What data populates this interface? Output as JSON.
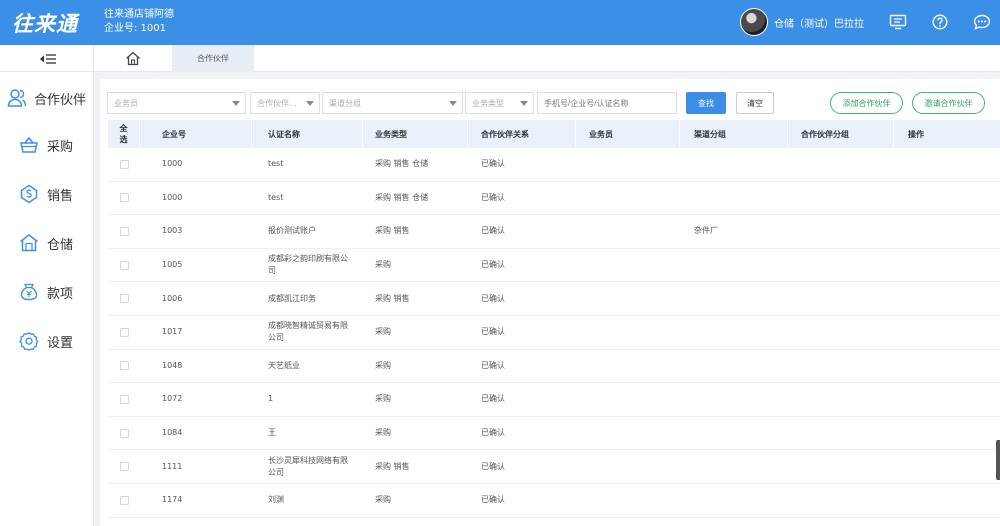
{
  "header": {
    "logo": "往来通",
    "shop_name": "往来通店铺阿德",
    "company_no": "企业号: 1001",
    "user_name": "仓储（测试）巴拉拉"
  },
  "tabs": {
    "active": "合作伙伴"
  },
  "sidebar": {
    "items": [
      {
        "label": "合作伙伴",
        "icon": "partner-icon"
      },
      {
        "label": "采购",
        "icon": "basket-icon"
      },
      {
        "label": "销售",
        "icon": "sales-icon"
      },
      {
        "label": "仓储",
        "icon": "warehouse-icon"
      },
      {
        "label": "款项",
        "icon": "money-icon"
      },
      {
        "label": "设置",
        "icon": "gear-icon"
      }
    ]
  },
  "filters": {
    "salesperson": "业务员",
    "partner_group": "合作伙伴...",
    "channel_group": "渠道分组",
    "business_type": "业务类型",
    "search_placeholder": "手机号/企业号/认证名称"
  },
  "buttons": {
    "search": "查找",
    "clear": "清空",
    "add_partner": "添加合作伙伴",
    "invite_partner": "邀请合作伙伴"
  },
  "table": {
    "headers": {
      "select_all": "全选",
      "company_no": "企业号",
      "cert_name": "认证名称",
      "business_type": "业务类型",
      "relation": "合作伙伴关系",
      "salesperson": "业务员",
      "channel": "渠道分组",
      "partner_group": "合作伙伴分组",
      "actions": "操作"
    },
    "rows": [
      {
        "id": "1000",
        "name": "test",
        "type": "采购 销售 仓储",
        "relation": "已确认",
        "channel": ""
      },
      {
        "id": "1000",
        "name": "test",
        "type": "采购 销售 仓储",
        "relation": "已确认",
        "channel": ""
      },
      {
        "id": "1003",
        "name": "报价测试账户",
        "type": "采购 销售",
        "relation": "已确认",
        "channel": "杂件厂"
      },
      {
        "id": "1005",
        "name": "成都彩之韵印刷有限公司",
        "type": "采购",
        "relation": "已确认",
        "channel": ""
      },
      {
        "id": "1006",
        "name": "成都凯江印务",
        "type": "采购 销售",
        "relation": "已确认",
        "channel": ""
      },
      {
        "id": "1017",
        "name": "成都晓智精诚贸易有限公司",
        "type": "采购",
        "relation": "已确认",
        "channel": ""
      },
      {
        "id": "1048",
        "name": "天艺纸业",
        "type": "采购",
        "relation": "已确认",
        "channel": ""
      },
      {
        "id": "1072",
        "name": "1",
        "type": "采购",
        "relation": "已确认",
        "channel": ""
      },
      {
        "id": "1084",
        "name": "王",
        "type": "采购",
        "relation": "已确认",
        "channel": ""
      },
      {
        "id": "1111",
        "name": "长沙灵犀科技网络有限公司",
        "type": "采购 销售",
        "relation": "已确认",
        "channel": ""
      },
      {
        "id": "1174",
        "name": "刘渊",
        "type": "采购",
        "relation": "已确认",
        "channel": ""
      }
    ]
  },
  "colors": {
    "header_bg": "#3b8fe6",
    "primary_button": "#3a8ee6",
    "green_outline": "#3db869",
    "table_header_bg": "#e9f1fb"
  }
}
